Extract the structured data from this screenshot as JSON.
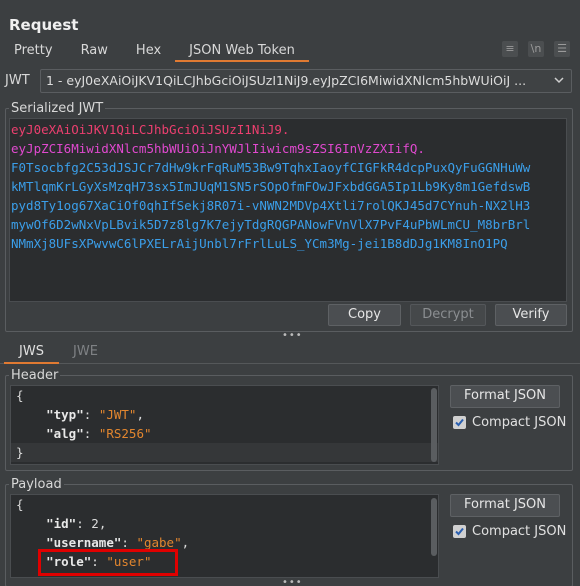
{
  "title": "Request",
  "tabs": [
    {
      "label": "Pretty",
      "active": false
    },
    {
      "label": "Raw",
      "active": false
    },
    {
      "label": "Hex",
      "active": false
    },
    {
      "label": "JSON Web Token",
      "active": true
    }
  ],
  "jwt_selector": {
    "label": "JWT",
    "value": "1 - eyJ0eXAiOiJKV1QiLCJhbGciOiJSUzI1NiJ9.eyJpZCI6MiwidXNlcm5hbWUiOiJ ..."
  },
  "serialized": {
    "legend": "Serialized JWT",
    "header_part": "eyJ0eXAiOiJKV1QiLCJhbGciOiJSUzI1NiJ9.",
    "payload_part": "eyJpZCI6MiwidXNlcm5hbWUiOiJnYWJlIiwicm9sZSI6InVzZXIifQ.",
    "signature_lines": [
      "F0Tsocbfg2C53dJSJCr7dHw9krFqRuM53Bw9TqhxIaoyfCIGFkR4dcpPuxQyFuGGNHuWw",
      "kMTlqmKrLGyXsMzqH73sx5ImJUqM1SN5rSOpOfmFOwJFxbdGGA5Ip1Lb9Ky8m1GefdswB",
      "pyd8Ty1og67XaCiOf0qhIfSekj8R07i-vNWN2MDVp4Xtli7rolQKJ45d7CYnuh-NX2lH3",
      "mywOf6D2wNxVpLBvik5D7z8lg7K7ejyTdgRQGPANowFVnVlX7PvF4uPbWLmCU_M8brBrl",
      "NMmXj8UFsXPwvwC6lPXELrAijUnbl7rFrlLuLS_YCm3Mg-jei1B8dDJg1KM8InO1PQ"
    ],
    "buttons": {
      "copy": "Copy",
      "decrypt": "Decrypt",
      "verify": "Verify"
    }
  },
  "sub_tabs": [
    {
      "label": "JWS",
      "active": true
    },
    {
      "label": "JWE",
      "active": false
    }
  ],
  "header_section": {
    "legend": "Header",
    "open_brace": "{",
    "close_brace": "}",
    "entries": [
      {
        "key": "\"typ\"",
        "value": "\"JWT\"",
        "comma": ","
      },
      {
        "key": "\"alg\"",
        "value": "\"RS256\"",
        "comma": ""
      }
    ],
    "format_button": "Format JSON",
    "compact_label": "Compact JSON"
  },
  "payload_section": {
    "legend": "Payload",
    "open_brace": "{",
    "entries": [
      {
        "key": "\"id\"",
        "value": "2",
        "comma": ","
      },
      {
        "key": "\"username\"",
        "value": "\"gabe\"",
        "comma": ","
      },
      {
        "key": "\"role\"",
        "value": "\"user\"",
        "comma": ""
      }
    ],
    "format_button": "Format JSON",
    "compact_label": "Compact JSON"
  },
  "colors": {
    "accent": "#e07a32",
    "header_segment": "#ec3f6f",
    "payload_segment": "#e049cf",
    "signature_segment": "#3b9fea",
    "highlight_box": "#e00000"
  }
}
